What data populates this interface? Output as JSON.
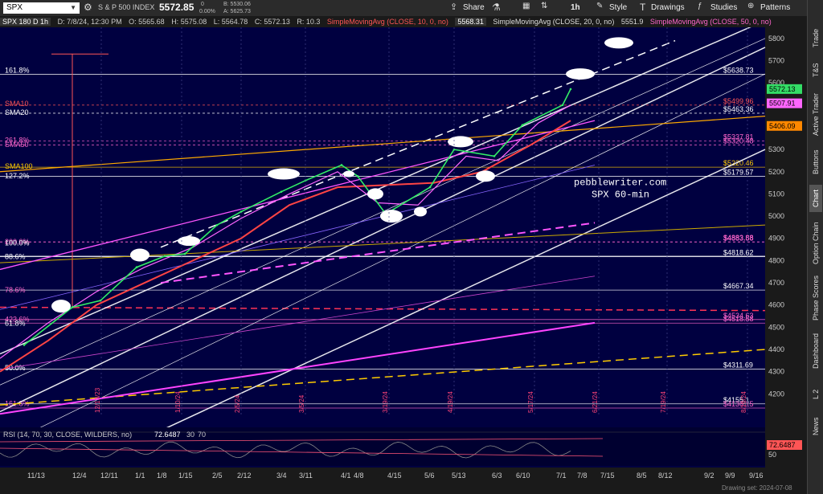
{
  "toolbar": {
    "symbol": "SPX",
    "description": "S & P 500 INDEX",
    "last": "5572.85",
    "change": "0",
    "change_pct": "0.00%",
    "bid": "B: 5530.06",
    "ask": "A: 5625.73",
    "share": "Share",
    "timeframe": "1h",
    "style": "Style",
    "drawings": "Drawings",
    "studies": "Studies",
    "patterns": "Patterns"
  },
  "status": {
    "chart_label": "SPX 180 D 1h",
    "date": "D: 7/8/24, 12:30 PM",
    "open": "O: 5565.68",
    "high": "H: 5575.08",
    "low": "L: 5564.78",
    "close": "C: 5572.13",
    "range": "R: 10.3",
    "sma10": "SimpleMovingAvg (CLOSE, 10, 0, no)",
    "sma10_val": "5568.31",
    "sma20": "SimpleMovingAvg (CLOSE, 20, 0, no)",
    "sma20_val": "5551.9",
    "sma50": "SimpleMovingAvg (CLOSE, 50, 0, no)"
  },
  "fib_labels": [
    {
      "text": "161.8%",
      "color": "#ffffff"
    },
    {
      "text": "SMA10",
      "color": "#ff5555"
    },
    {
      "text": "SMA20",
      "color": "#ffffff"
    },
    {
      "text": "261.8%",
      "color": "#ff66cc"
    },
    {
      "text": "SMA50",
      "color": "#ff66cc"
    },
    {
      "text": "SMA100",
      "color": "#ffcc00"
    },
    {
      "text": "127.2%",
      "color": "#ffffff"
    },
    {
      "text": "200.0%",
      "color": "#ff66cc"
    },
    {
      "text": "100.0%",
      "color": "#ffffff"
    },
    {
      "text": "88.6%",
      "color": "#ffffff"
    },
    {
      "text": "78.6%",
      "color": "#ff66cc"
    },
    {
      "text": "423.6%",
      "color": "#ff66cc"
    },
    {
      "text": "61.8%",
      "color": "#ffffff"
    },
    {
      "text": "50.0%",
      "color": "#ffffff"
    },
    {
      "text": "161.8%",
      "color": "#ff66cc"
    }
  ],
  "level_labels": [
    {
      "text": "$5638.73",
      "color": "#ffffff"
    },
    {
      "text": "$5499.96",
      "color": "#ff5555"
    },
    {
      "text": "$5463.36",
      "color": "#ffffff"
    },
    {
      "text": "$5337.81",
      "color": "#ff66cc"
    },
    {
      "text": "$5320.48",
      "color": "#ff66cc"
    },
    {
      "text": "$5220.46",
      "color": "#ffcc00"
    },
    {
      "text": "$5179.57",
      "color": "#ffffff"
    },
    {
      "text": "$4883.88",
      "color": "#ff66cc"
    },
    {
      "text": "$4883.58",
      "color": "#ff66cc"
    },
    {
      "text": "$4818.62",
      "color": "#ffffff"
    },
    {
      "text": "$4667.34",
      "color": "#ffffff"
    },
    {
      "text": "$4534.63",
      "color": "#ff66cc"
    },
    {
      "text": "$4518.58",
      "color": "#ff66cc"
    },
    {
      "text": "$4311.69",
      "color": "#ffffff"
    },
    {
      "text": "$4155.1",
      "color": "#ffffff"
    },
    {
      "text": "$4136.15",
      "color": "#ff66cc"
    }
  ],
  "price_tags": [
    {
      "text": "5572.13",
      "bg": "#33dd66",
      "fg": "#000000"
    },
    {
      "text": "5507.91",
      "bg": "#ff66ff",
      "fg": "#000000"
    },
    {
      "text": "5406.09",
      "bg": "#ff8800",
      "fg": "#000000"
    },
    {
      "text": "72.6487",
      "bg": "#ff5555",
      "fg": "#000000"
    }
  ],
  "price_axis": [
    "5800",
    "5700",
    "5600",
    "5500",
    "5400",
    "5300",
    "5200",
    "5100",
    "5000",
    "4900",
    "4800",
    "4700",
    "4600",
    "4500",
    "4400",
    "4300",
    "4200"
  ],
  "rsi_axis": [
    "50"
  ],
  "time_axis": [
    "11/13",
    "12/4",
    "12/11",
    "1/1",
    "1/8",
    "1/15",
    "2/5",
    "2/12",
    "3/4",
    "3/11",
    "4/1",
    "4/8",
    "4/15",
    "5/6",
    "5/13",
    "6/3",
    "6/10",
    "7/1",
    "7/8",
    "7/15",
    "8/5",
    "8/12",
    "9/2",
    "9/9",
    "9/16"
  ],
  "watermark": {
    "line1": "pebblewriter.com",
    "line2": "SPX 60-min"
  },
  "rsi": {
    "label": "RSI (14, 70, 30, CLOSE, WILDERS, no)",
    "value": "72.6487",
    "ob": "30",
    "os": "70"
  },
  "drawing_set": "Drawing set: 2024-07-08",
  "right_nav": [
    "Trade",
    "T&S",
    "Active Trader",
    "Buttons",
    "Chart",
    "Option Chain",
    "Phase Scores",
    "Dashboard",
    "L 2",
    "News"
  ],
  "vertical_dates": [
    "12/13/23",
    "1/10/24",
    "2/5/24",
    "3/5/24",
    "3/19/24",
    "4/19/24",
    "5/17/24",
    "6/21/24",
    "7/19/24",
    "8/16/24",
    "9/20/24"
  ],
  "chart_data": {
    "type": "line",
    "title": "SPX 180 D 1h",
    "ylim": [
      4100,
      5850
    ],
    "x": [
      "11/13",
      "12/4",
      "12/11",
      "1/1",
      "1/8",
      "1/15",
      "2/5",
      "2/12",
      "3/4",
      "3/11",
      "4/1",
      "4/8",
      "4/15",
      "5/6",
      "5/13",
      "6/3",
      "6/10",
      "7/1",
      "7/8"
    ],
    "series": [
      {
        "name": "SPX",
        "values": [
          4420,
          4590,
          4620,
          4770,
          4820,
          4830,
          4960,
          5020,
          5110,
          5160,
          5230,
          5180,
          5010,
          5130,
          5300,
          5270,
          5410,
          5500,
          5572
        ]
      }
    ]
  }
}
